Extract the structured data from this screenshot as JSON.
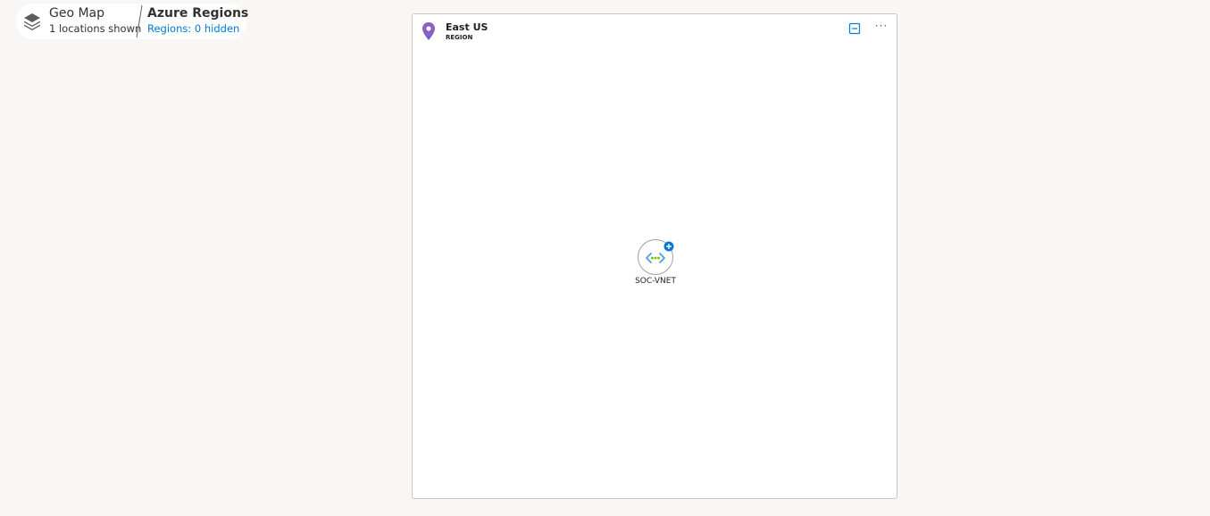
{
  "breadcrumb": {
    "root": {
      "title": "Geo Map",
      "subtitle": "1 locations shown"
    },
    "current": {
      "title": "Azure Regions",
      "link": "Regions: 0 hidden"
    }
  },
  "region": {
    "name": "East US",
    "type": "REGION",
    "more_label": "···",
    "pin_color": "#8661c5"
  },
  "nodes": [
    {
      "label": "SOC-VNET",
      "icon": "virtual-network-icon",
      "badge": "expand-plus-icon"
    }
  ],
  "colors": {
    "background": "#f8f7f5",
    "link": "#0078d4",
    "badge": "#0078d4"
  }
}
